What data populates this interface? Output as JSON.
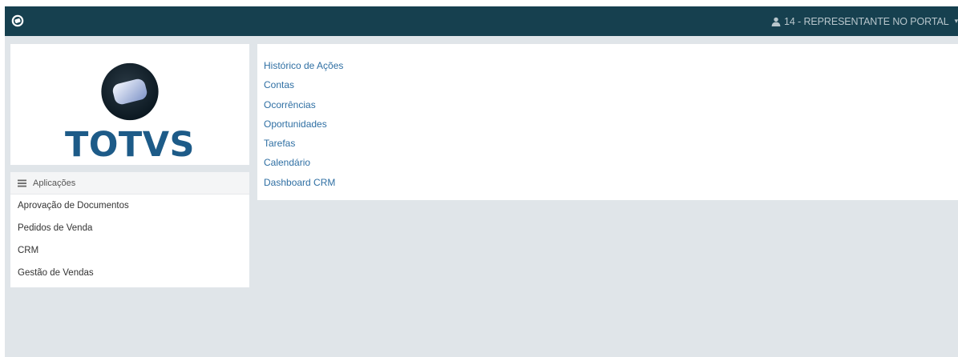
{
  "topbar": {
    "user_label": "14 - REPRESENTANTE NO PORTAL",
    "bg_color": "#16404f",
    "icons": [
      "portal-logo-icon",
      "user-icon",
      "caret-down-icon"
    ]
  },
  "brand": {
    "name": "TOTVS",
    "color": "#1d5b88"
  },
  "apps": {
    "header": "Aplicações",
    "header_icon": "list-icon",
    "items": [
      {
        "label": "Aprovação de Documentos"
      },
      {
        "label": "Pedidos de Venda"
      },
      {
        "label": "CRM"
      },
      {
        "label": "Gestão de Vendas"
      }
    ]
  },
  "crm_menu": {
    "link_color": "#2f6fa3",
    "items": [
      {
        "label": "Histórico de Ações"
      },
      {
        "label": "Contas"
      },
      {
        "label": "Ocorrências"
      },
      {
        "label": "Oportunidades"
      },
      {
        "label": "Tarefas"
      },
      {
        "label": "Calendário"
      },
      {
        "label": "Dashboard CRM"
      }
    ]
  }
}
